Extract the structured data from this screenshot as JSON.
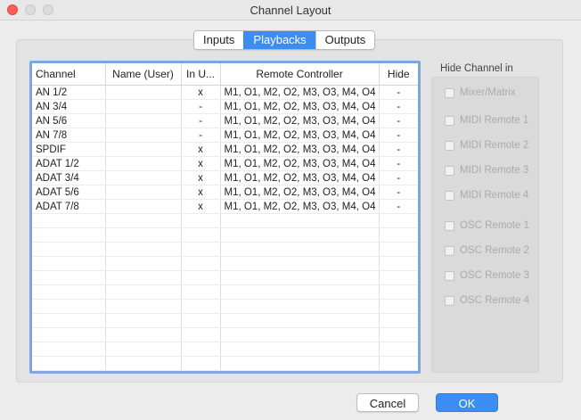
{
  "window": {
    "title": "Channel Layout"
  },
  "tabs": [
    {
      "label": "Inputs",
      "active": false
    },
    {
      "label": "Playbacks",
      "active": true
    },
    {
      "label": "Outputs",
      "active": false
    }
  ],
  "table": {
    "headers": [
      "Channel",
      "Name (User)",
      "In U...",
      "Remote Controller",
      "Hide"
    ],
    "rows": [
      [
        "AN 1/2",
        "",
        "x",
        "M1, O1, M2, O2, M3, O3, M4, O4",
        "-"
      ],
      [
        "AN 3/4",
        "",
        "-",
        "M1, O1, M2, O2, M3, O3, M4, O4",
        "-"
      ],
      [
        "AN 5/6",
        "",
        "-",
        "M1, O1, M2, O2, M3, O3, M4, O4",
        "-"
      ],
      [
        "AN 7/8",
        "",
        "-",
        "M1, O1, M2, O2, M3, O3, M4, O4",
        "-"
      ],
      [
        "SPDIF",
        "",
        "x",
        "M1, O1, M2, O2, M3, O3, M4, O4",
        "-"
      ],
      [
        "ADAT 1/2",
        "",
        "x",
        "M1, O1, M2, O2, M3, O3, M4, O4",
        "-"
      ],
      [
        "ADAT 3/4",
        "",
        "x",
        "M1, O1, M2, O2, M3, O3, M4, O4",
        "-"
      ],
      [
        "ADAT 5/6",
        "",
        "x",
        "M1, O1, M2, O2, M3, O3, M4, O4",
        "-"
      ],
      [
        "ADAT 7/8",
        "",
        "x",
        "M1, O1, M2, O2, M3, O3, M4, O4",
        "-"
      ]
    ],
    "empty_rows": 12
  },
  "hide_channel": {
    "label": "Hide Channel in",
    "options": [
      "Mixer/Matrix",
      "MIDI Remote 1",
      "MIDI Remote 2",
      "MIDI Remote 3",
      "MIDI Remote 4",
      "OSC Remote 1",
      "OSC Remote 2",
      "OSC Remote 3",
      "OSC Remote 4"
    ]
  },
  "buttons": {
    "cancel": "Cancel",
    "ok": "OK"
  },
  "colors": {
    "accent": "#3b8df4",
    "close": "#fc5f57"
  }
}
